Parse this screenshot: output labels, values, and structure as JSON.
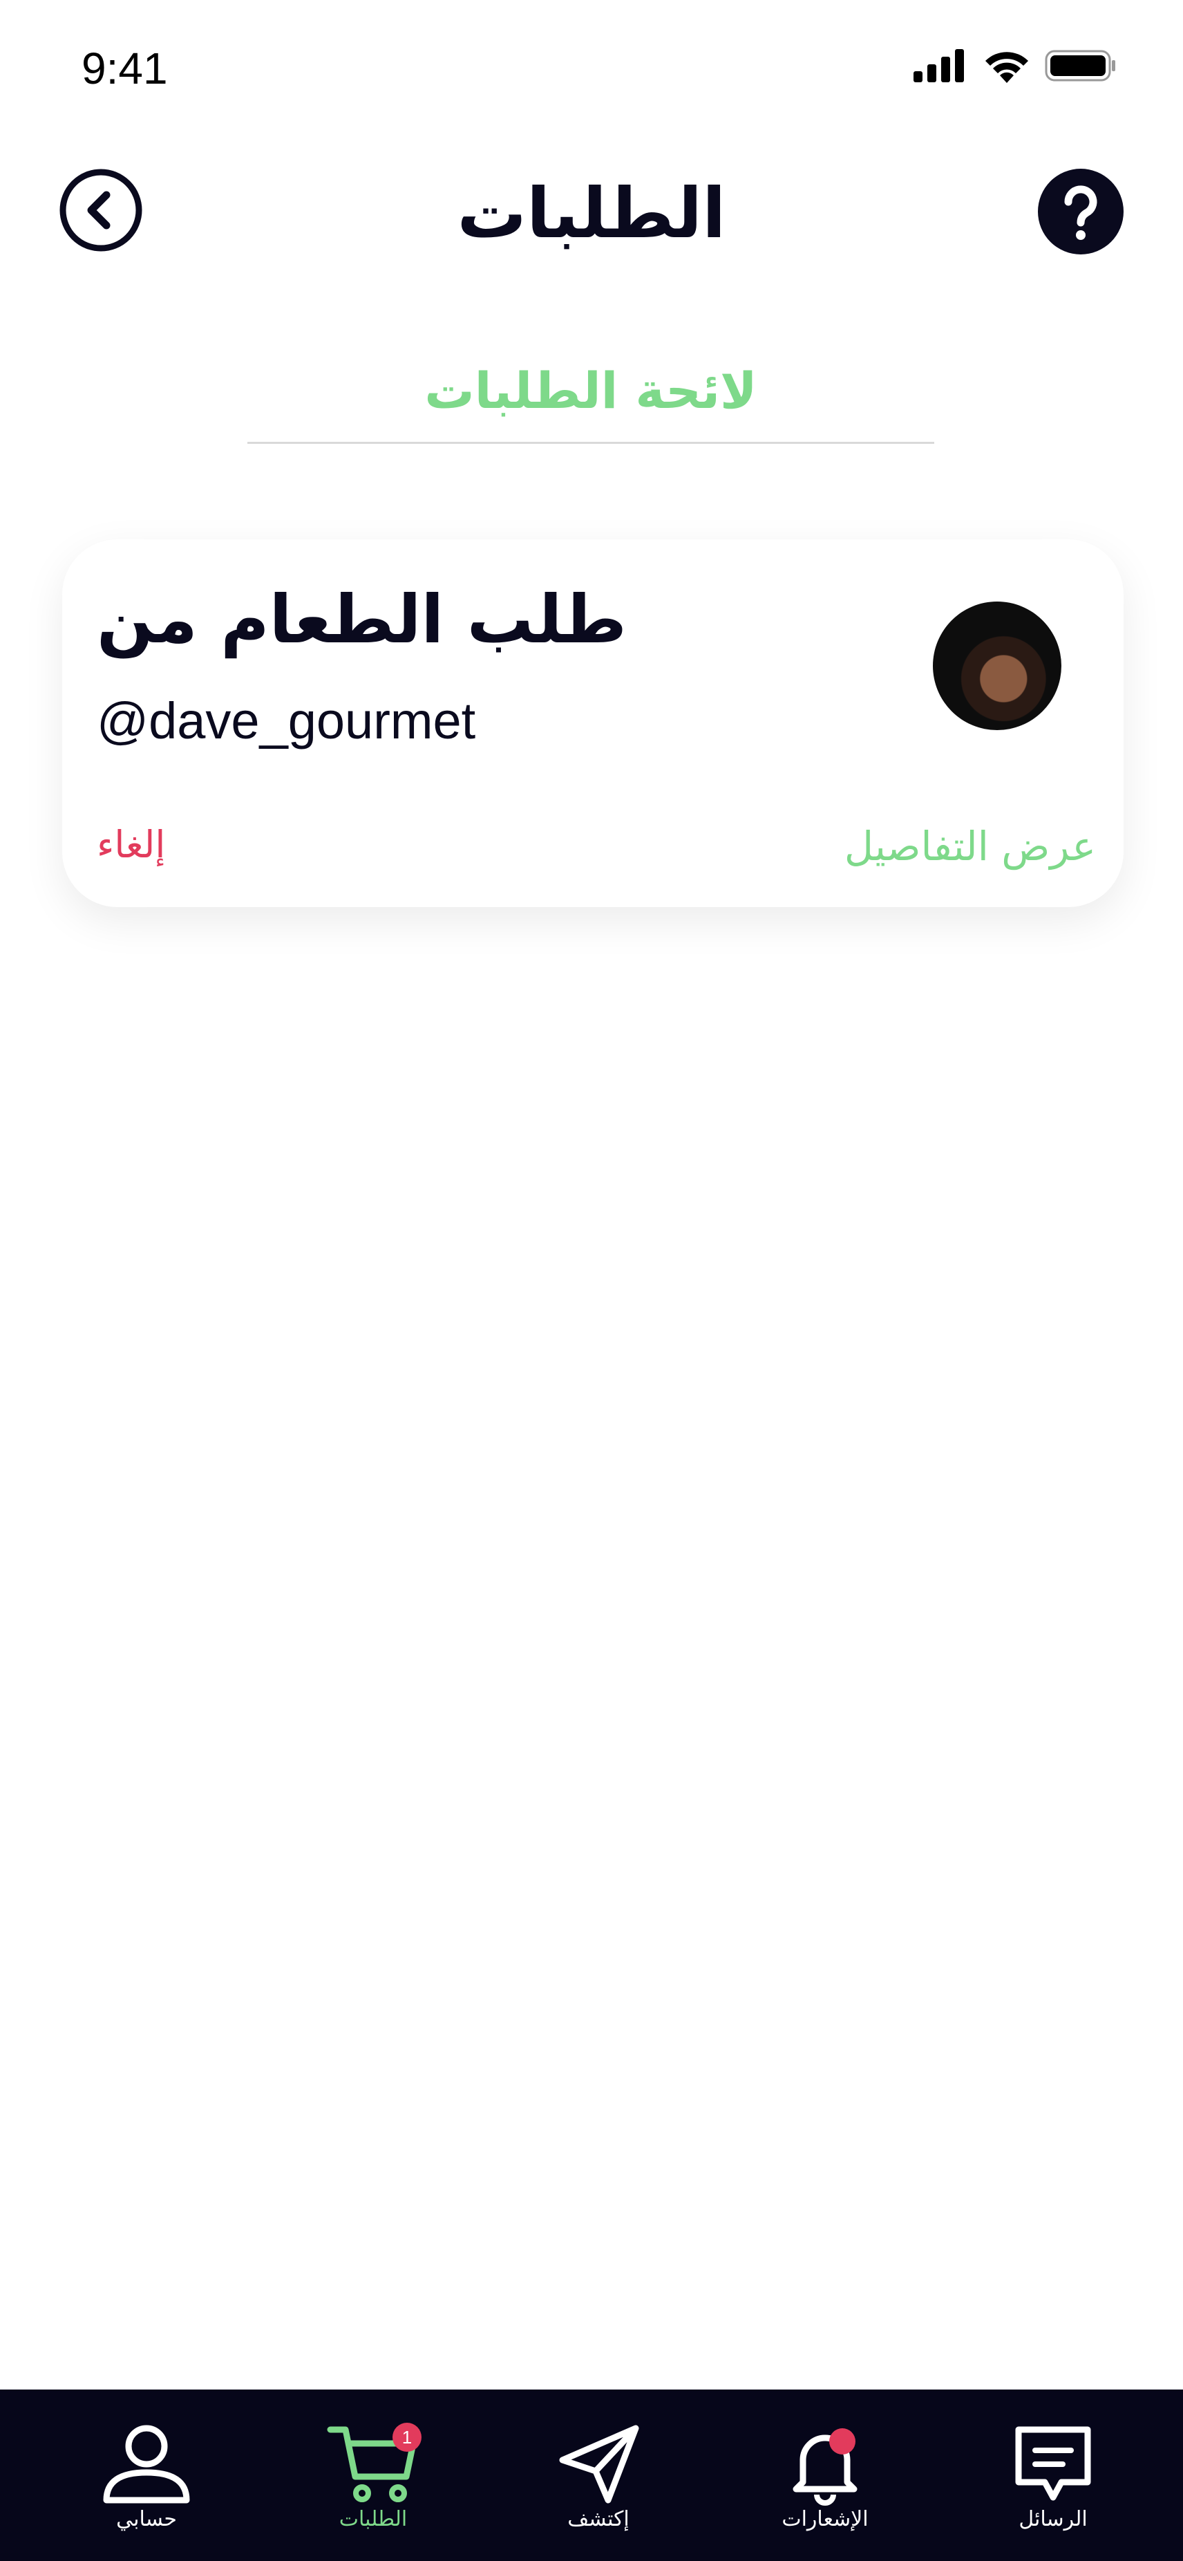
{
  "status_bar": {
    "time": "9:41"
  },
  "header": {
    "title": "الطلبات"
  },
  "tabs": [
    {
      "label": "لائحة الطلبات"
    }
  ],
  "order_card": {
    "title": "طلب الطعام من",
    "username": "@dave_gourmet",
    "cancel_label": "إلغاء",
    "details_label": "عرض التفاصيل"
  },
  "bottom_nav": {
    "items": [
      {
        "label": "حسابي",
        "icon": "user-icon"
      },
      {
        "label": "الطلبات",
        "icon": "cart-icon",
        "badge": "1",
        "active": true
      },
      {
        "label": "إكتشف",
        "icon": "send-icon"
      },
      {
        "label": "الإشعارات",
        "icon": "bell-icon"
      },
      {
        "label": "الرسائل",
        "icon": "message-icon"
      }
    ]
  },
  "colors": {
    "accent": "#7ed98a",
    "danger": "#e23b5c",
    "nav_bg": "#06061a",
    "text": "#0a0a1e"
  }
}
